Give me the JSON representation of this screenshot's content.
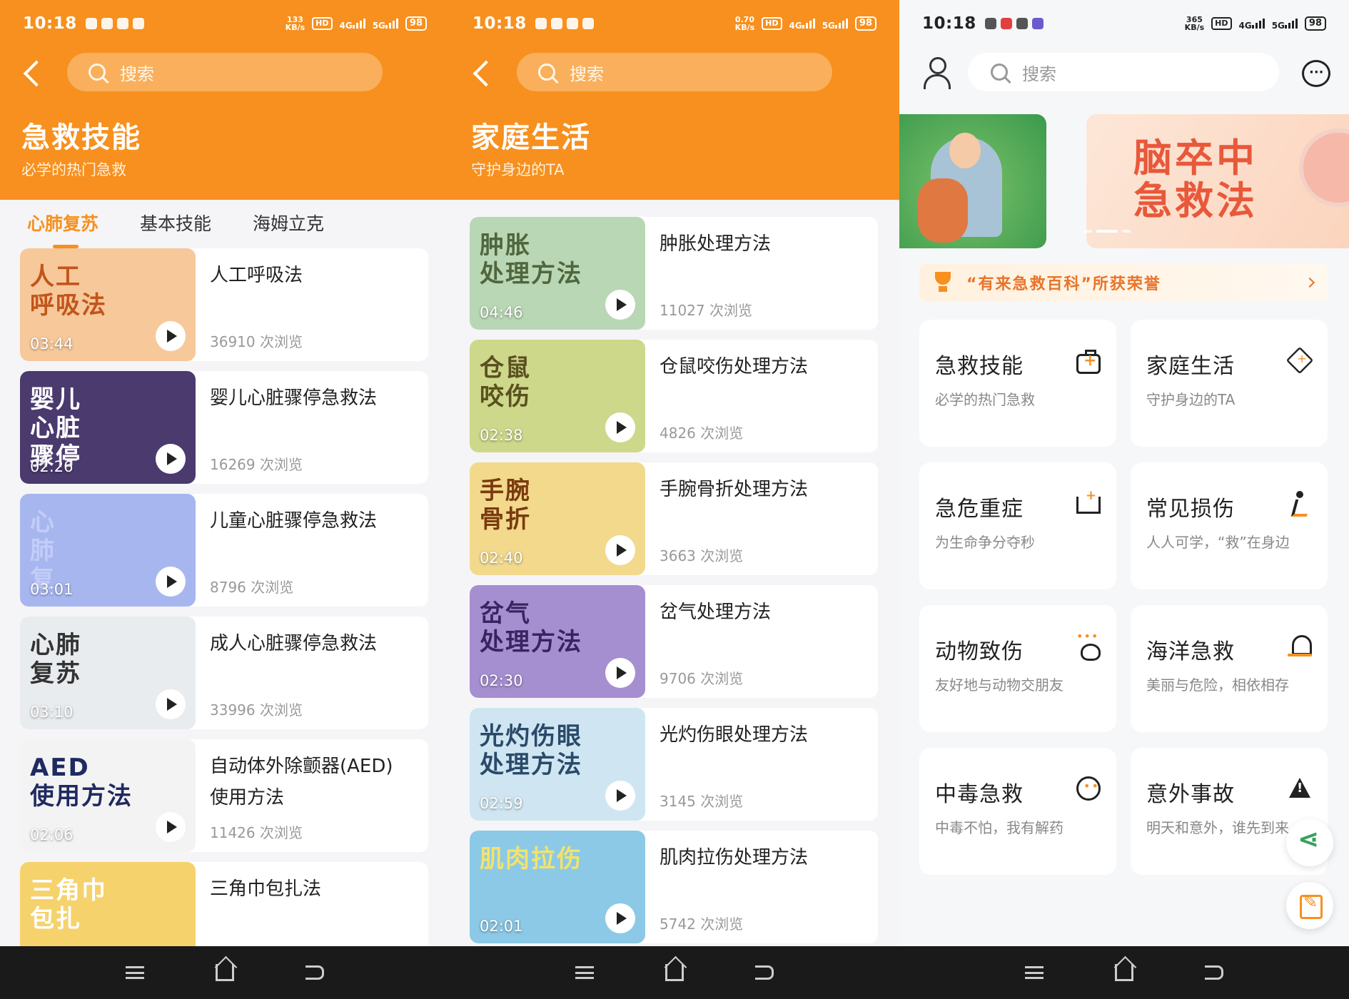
{
  "status": {
    "time": "10:18",
    "battery": "98",
    "hd": "HD",
    "net4g": "4G",
    "net5g": "5G",
    "speeds": [
      [
        "133",
        "KB/s"
      ],
      [
        "0.70",
        "KB/s"
      ],
      [
        "365",
        "KB/s"
      ]
    ]
  },
  "screen1": {
    "search_placeholder": "搜索",
    "title": "急救技能",
    "subtitle": "必学的热门急救",
    "tabs": [
      "心肺复苏",
      "基本技能",
      "海姆立克"
    ],
    "videos": [
      {
        "title": "人工呼吸法",
        "views": "36910 次浏览",
        "duration": "03:44",
        "thumb_text": "人工\n呼吸法",
        "bg": "#f6c89a",
        "fg": "#c2551b"
      },
      {
        "title": "婴儿心脏骤停急救法",
        "views": "16269 次浏览",
        "duration": "02:26",
        "thumb_text": "婴儿\n心脏\n骤停",
        "bg": "#4a3a6e",
        "fg": "#ffffff"
      },
      {
        "title": "儿童心脏骤停急救法",
        "views": "8796 次浏览",
        "duration": "03:01",
        "thumb_text": "心\n肺\n复",
        "bg": "#a7b6ef",
        "fg": "#c3cdf7"
      },
      {
        "title": "成人心脏骤停急救法",
        "views": "33996 次浏览",
        "duration": "03:10",
        "thumb_text": "心肺\n复苏",
        "bg": "#e9ecef",
        "fg": "#333333"
      },
      {
        "title": "自动体外除颤器(AED) 使用方法",
        "views": "11426 次浏览",
        "duration": "02:06",
        "thumb_text": "AED\n使用方法",
        "bg": "#f3f3f3",
        "fg": "#1e2a60"
      },
      {
        "title": "三角巾包扎法",
        "views": "",
        "duration": "",
        "thumb_text": "三角巾\n包扎",
        "bg": "#f6d26c",
        "fg": "#ffffff"
      }
    ]
  },
  "screen2": {
    "search_placeholder": "搜索",
    "title": "家庭生活",
    "subtitle": "守护身边的TA",
    "videos": [
      {
        "title": "肿胀处理方法",
        "views": "11027 次浏览",
        "duration": "04:46",
        "thumb_text": "肿胀\n处理方法",
        "bg": "#b9d7b4",
        "fg": "#50663f"
      },
      {
        "title": "仓鼠咬伤处理方法",
        "views": "4826 次浏览",
        "duration": "02:38",
        "thumb_text": "仓鼠\n咬伤",
        "bg": "#cdd88a",
        "fg": "#5a5020"
      },
      {
        "title": "手腕骨折处理方法",
        "views": "3663 次浏览",
        "duration": "02:40",
        "thumb_text": "手腕\n骨折",
        "bg": "#f2d98c",
        "fg": "#7a3a10"
      },
      {
        "title": "岔气处理方法",
        "views": "9706 次浏览",
        "duration": "02:30",
        "thumb_text": "岔气\n处理方法",
        "bg": "#a58fd0",
        "fg": "#3a2460"
      },
      {
        "title": "光灼伤眼处理方法",
        "views": "3145 次浏览",
        "duration": "02:59",
        "thumb_text": "光灼伤眼\n处理方法",
        "bg": "#cfe6f2",
        "fg": "#2a4a6a"
      },
      {
        "title": "肌肉拉伤处理方法",
        "views": "5742 次浏览",
        "duration": "02:01",
        "thumb_text": "肌肉拉伤",
        "bg": "#8cc9e6",
        "fg": "#f3e36a"
      }
    ]
  },
  "screen3": {
    "search_placeholder": "搜索",
    "banner_text": "脑卒中\n急救法",
    "honor_text": "“有来急救百科”所获荣誉",
    "categories": [
      {
        "title": "急救技能",
        "sub": "必学的热门急救",
        "icon": "first-aid-kit-icon",
        "ic": "ic-kit"
      },
      {
        "title": "家庭生活",
        "sub": "守护身边的TA",
        "icon": "house-icon",
        "ic": "ic-house"
      },
      {
        "title": "急危重症",
        "sub": "为生命争分夺秒",
        "icon": "hospital-bed-icon",
        "ic": "ic-bed"
      },
      {
        "title": "常见损伤",
        "sub": "人人可学，“救”在身边",
        "icon": "running-person-icon",
        "ic": "ic-run"
      },
      {
        "title": "动物致伤",
        "sub": "友好地与动物交朋友",
        "icon": "paw-icon",
        "ic": "ic-paw"
      },
      {
        "title": "海洋急救",
        "sub": "美丽与危险，相依相存",
        "icon": "ocean-rescue-icon",
        "ic": "ic-sea"
      },
      {
        "title": "中毒急救",
        "sub": "中毒不怕，我有解药",
        "icon": "skull-icon",
        "ic": "ic-skull"
      },
      {
        "title": "意外事故",
        "sub": "明天和意外，谁先到来",
        "icon": "warning-icon",
        "ic": "ic-warn"
      }
    ]
  },
  "colors": {
    "accent": "#f7901e",
    "bg": "#f5f5f7",
    "text": "#222222",
    "muted": "#999999"
  }
}
